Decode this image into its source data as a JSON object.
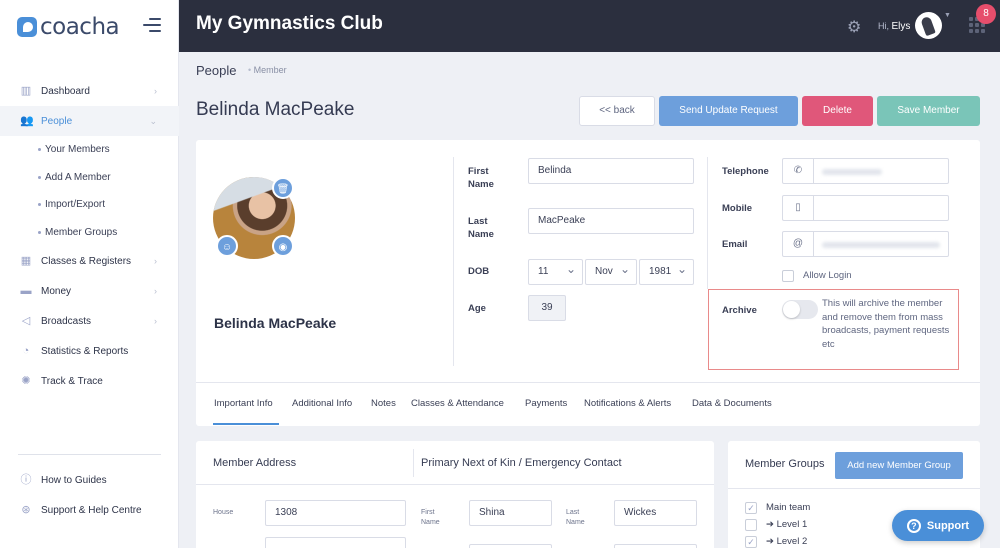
{
  "brand": {
    "name": "coacha"
  },
  "header": {
    "club_name": "My Gymnastics Club",
    "greeting": "Hi,",
    "user": "Elys",
    "notifications": "8"
  },
  "sidebar": {
    "items": [
      {
        "label": "Dashboard",
        "icon": "chart-icon"
      },
      {
        "label": "People",
        "icon": "people-icon"
      },
      {
        "label": "Classes & Registers",
        "icon": "calendar-icon"
      },
      {
        "label": "Money",
        "icon": "money-icon"
      },
      {
        "label": "Broadcasts",
        "icon": "megaphone-icon"
      },
      {
        "label": "Statistics & Reports",
        "icon": "pie-chart-icon"
      },
      {
        "label": "Track & Trace",
        "icon": "virus-icon"
      }
    ],
    "people_sub": [
      "Your Members",
      "Add A Member",
      "Import/Export",
      "Member Groups"
    ],
    "bottom": [
      {
        "label": "How to Guides",
        "icon": "info-icon"
      },
      {
        "label": "Support & Help Centre",
        "icon": "lifebuoy-icon"
      }
    ]
  },
  "breadcrumb": {
    "title": "People",
    "sub": "Member"
  },
  "page": {
    "heading": "Belinda MacPeake"
  },
  "buttons": {
    "back": "<< back",
    "update": "Send Update Request",
    "delete": "Delete",
    "save": "Save Member"
  },
  "profile": {
    "name": "Belinda MacPeake",
    "first_name_label": "First Name",
    "first_name": "Belinda",
    "last_name_label": "Last Name",
    "last_name": "MacPeake",
    "dob_label": "DOB",
    "dob_day": "11",
    "dob_month": "Nov",
    "dob_year": "1981",
    "age_label": "Age",
    "age": "39",
    "telephone_label": "Telephone",
    "mobile_label": "Mobile",
    "email_label": "Email",
    "allow_login": "Allow Login",
    "archive_label": "Archive",
    "archive_text": "This will archive the member and remove them from mass broadcasts, payment requests etc"
  },
  "tabs": [
    "Important Info",
    "Additional Info",
    "Notes",
    "Classes & Attendance",
    "Payments",
    "Notifications & Alerts",
    "Data & Documents"
  ],
  "address": {
    "title": "Member Address",
    "kin_title": "Primary Next of Kin / Emergency Contact",
    "house_label": "House",
    "house": "1308",
    "first_name_label": "First Name",
    "kin_first": "Shina",
    "last_name_label": "Last Name",
    "kin_last": "Wickes"
  },
  "groups": {
    "title": "Member Groups",
    "add_button": "Add new Member Group",
    "items": [
      "Main team",
      "➔ Level 1",
      "➔ Level 2"
    ]
  },
  "support": {
    "label": "Support"
  }
}
